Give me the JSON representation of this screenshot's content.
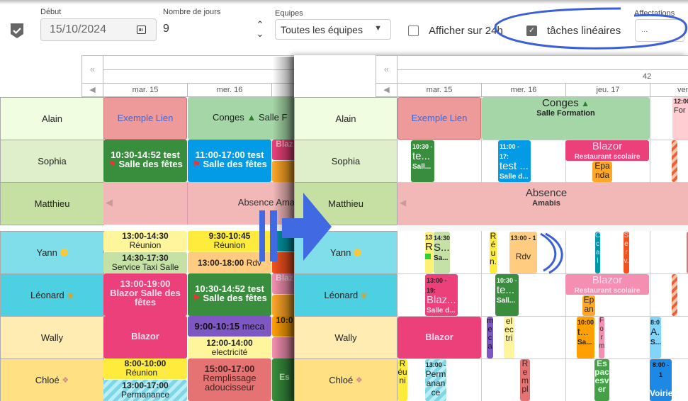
{
  "toolbar": {
    "debut_label": "Début",
    "debut_value": "15/10/2024",
    "nb_jours_label": "Nombre de jours",
    "nb_jours_value": "9",
    "equipes_label": "Equipes",
    "equipes_value": "Toutes les équipes",
    "afficher24h_label": "Afficher sur 24h",
    "afficher24h_checked": false,
    "taches_lineaires_label": "tâches linéaires",
    "taches_lineaires_checked": true,
    "affectations_label": "Affectations",
    "affectations_value": "..."
  },
  "left_view": {
    "days": [
      "mar. 15",
      "mer. 16"
    ],
    "resources": [
      "Alain",
      "Sophia",
      "Matthieu",
      "Yann",
      "Léonard",
      "Wally",
      "Chloé"
    ],
    "events": {
      "alain_1": "Exemple Lien",
      "alain_2": "Conges",
      "alain_2b": "Salle F",
      "sophia_1_time": "10:30-14:52",
      "sophia_1_title": "test",
      "sophia_1_loc": "Salle des fêtes",
      "sophia_2_time": "11:00-17:00",
      "sophia_2_title": "test",
      "sophia_2_loc": "Salle des fêtes",
      "sophia_3": "Blaz",
      "matthieu_1": "Absence Ama",
      "yann_1_time": "13:00-14:30",
      "yann_1_title": "Réunion",
      "yann_2_time": "14:30-17:30",
      "yann_2_title": "Service Taxi Salle",
      "yann_3_time": "9:30-10:45",
      "yann_3_title": "Réunion",
      "yann_4_time": "13:00-18:00",
      "yann_4_title": "Rdv",
      "leonard_1_time": "13:00-19:00",
      "leonard_1_title": "Blazor Salle des fêtes",
      "leonard_2_time": "10:30-14:52",
      "leonard_2_title": "test",
      "leonard_2_loc": "Salle des fêtes",
      "leonard_3": "Blaz",
      "wally_1": "Blazor",
      "wally_2_time": "9:00-10:15",
      "wally_2_title": "meca",
      "wally_3_time": "12:00-14:00",
      "wally_3_title": "electricité",
      "wally_4": "10:0",
      "chloe_1_time": "8:00-10:00",
      "chloe_1_title": "Réunion",
      "chloe_2_time": "13:00-17:00",
      "chloe_2_title": "Permanance",
      "chloe_3_time": "15:00-17:00",
      "chloe_3_title": "Remplissage adoucisseur",
      "chloe_4": "Es"
    }
  },
  "right_view": {
    "week_number": "42",
    "days": [
      "mar. 15",
      "mer. 16",
      "jeu. 17",
      "ven"
    ],
    "resources": [
      "Alain",
      "Sophia",
      "Matthieu",
      "Yann",
      "Léonard",
      "Wally",
      "Chloé"
    ],
    "events": {
      "alain_1": "Exemple Lien",
      "alain_2": "Conges",
      "alain_2_loc": "Salle Formation",
      "alain_3_time": "12:00",
      "alain_3_title": "For ic",
      "sophia_1_time": "10:30 -",
      "sophia_1_title": "te...",
      "sophia_1_loc": "Sall...",
      "sophia_2_time": "11:00 - 17:",
      "sophia_2_title": "test ...",
      "sophia_2_loc": "Salle d...",
      "sophia_3": "Blazor",
      "sophia_3_loc": "Restaurant scolaire",
      "sophia_4": "Epa nda",
      "matthieu_1": "Absence",
      "matthieu_1_loc": "Amabis",
      "yann_1_time": "13",
      "yann_1_title": "R",
      "yann_2_time": "14:30",
      "yann_2_title": "S...",
      "yann_2_loc": "Sa...",
      "yann_3": "Réun.",
      "yann_4_time": "13:00 - 1",
      "yann_4_title": "Rdv",
      "yann_5": "Ccal",
      "yann_6": "Serv.",
      "leonard_1_time": "13:00 - 19:",
      "leonard_1_title": "Blaz...",
      "leonard_1_loc": "Salle d...",
      "leonard_2_time": "10:30 -",
      "leonard_2_title": "te...",
      "leonard_2_loc": "Sall...",
      "leonard_3": "Blazor",
      "leonard_3_loc": "Restaurant scolaire",
      "leonard_4": "Ep an",
      "wally_1": "Blazor",
      "wally_2": "meca",
      "wally_3": "electri",
      "wally_4_time": "10:00",
      "wally_4_title": "t...",
      "wally_4_loc": "Sa...",
      "wally_5": "Form",
      "wally_6_time": "8:0",
      "wally_6_title": "A.",
      "wally_6_loc": "S...",
      "chloe_1": "Réuni",
      "chloe_2_time": "13:00 -",
      "chloe_2_title": "Permanance",
      "chloe_3": "Rempl",
      "chloe_4": "Espacesver",
      "chloe_5_time": "8:00 - 1",
      "chloe_5_title": "Voirie"
    }
  },
  "colors": {
    "annotation_blue": "#3b5fd9",
    "alain_bg": "#f1fde0",
    "sophia_bg": "#e0efcb",
    "matthieu_bg": "#c6e0a4",
    "yann_bg": "#80deea",
    "leonard_bg": "#4dd0e1",
    "wally_bg": "#ffecb3",
    "chloe_bg": "#ffe082"
  }
}
